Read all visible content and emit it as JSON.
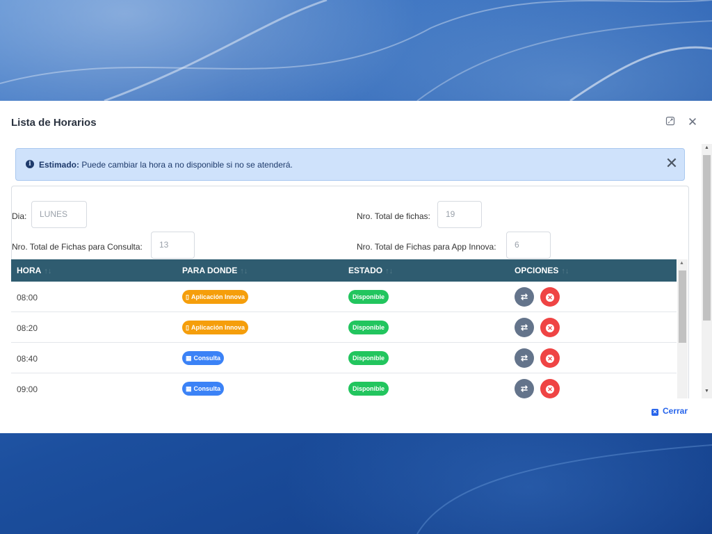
{
  "modal": {
    "title": "Lista de Horarios",
    "maximize_icon": "maximize-icon",
    "close_icon": "close-icon"
  },
  "alert": {
    "icon": "info-icon",
    "strong": "Estimado:",
    "text": " Puede cambiar la hora a no disponible si no se atenderá.",
    "close_glyph": "✕"
  },
  "fields": {
    "dia": {
      "label": "Dia:",
      "value": "LUNES"
    },
    "total_fichas": {
      "label": "Nro. Total de fichas:",
      "value": "19"
    },
    "fichas_consulta": {
      "label": "Nro. Total de Fichas para Consulta:",
      "value": "13"
    },
    "fichas_app": {
      "label": "Nro. Total de Fichas para App Innova:",
      "value": "6"
    }
  },
  "table": {
    "headers": [
      "HORA",
      "PARA DONDE",
      "ESTADO",
      "OPCIONES"
    ],
    "sort_glyph": "↑↓",
    "rows": [
      {
        "hora": "08:00",
        "destino": "Aplicación Innova",
        "destino_type": "app",
        "estado": "Disponible"
      },
      {
        "hora": "08:20",
        "destino": "Aplicación Innova",
        "destino_type": "app",
        "estado": "Disponible"
      },
      {
        "hora": "08:40",
        "destino": "Consulta",
        "destino_type": "consulta",
        "estado": "Disponible"
      },
      {
        "hora": "09:00",
        "destino": "Consulta",
        "destino_type": "consulta",
        "estado": "Disponible"
      }
    ]
  },
  "footer": {
    "close_label": "Cerrar"
  },
  "colors": {
    "header_bg": "#2f5c70",
    "app_badge": "#f59e0b",
    "consulta_badge": "#3b82f6",
    "disponible_badge": "#22c55e",
    "swap_button": "#64748b",
    "cancel_button": "#ef4444",
    "alert_bg": "#cfe2fb"
  }
}
